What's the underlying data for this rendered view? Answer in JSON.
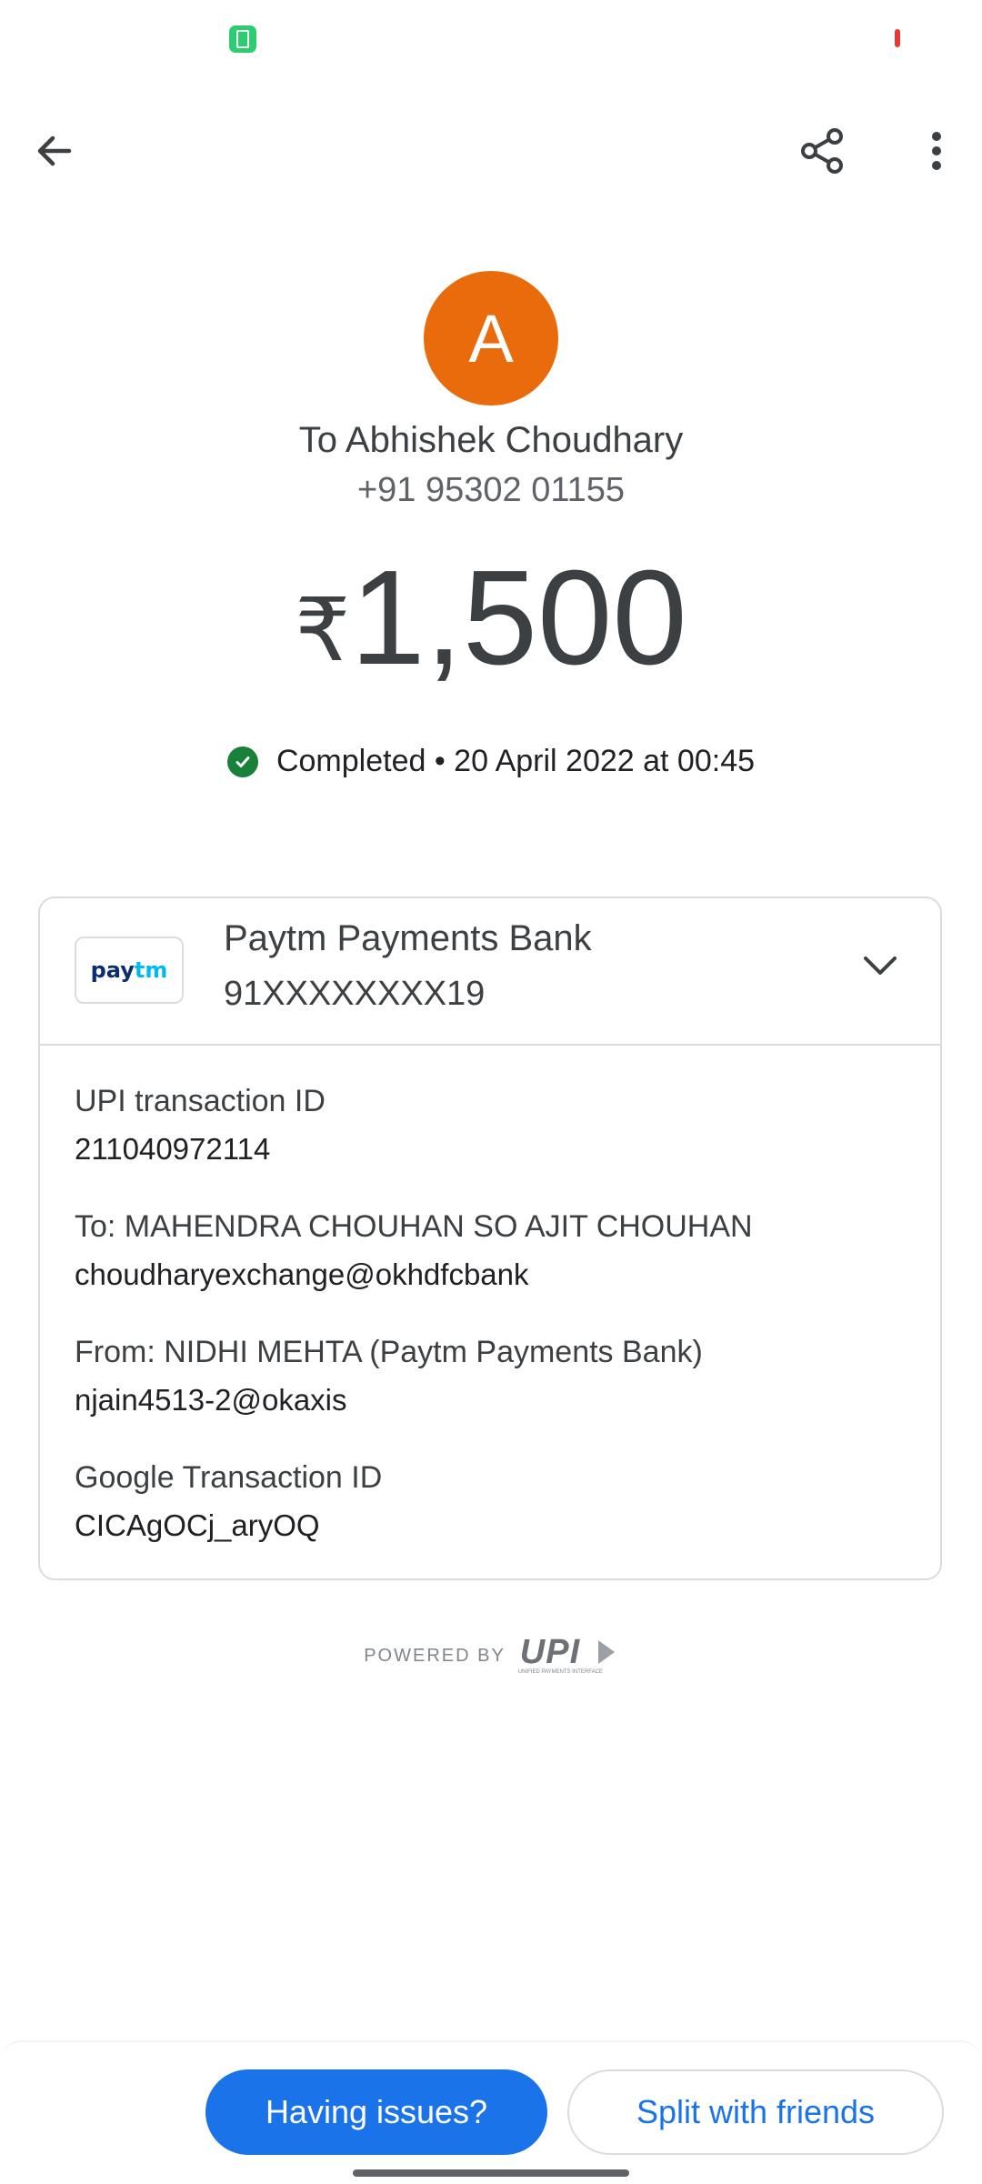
{
  "status_bar": {
    "battery_icon": "battery-icon",
    "indicator_color": "#e53935"
  },
  "top_bar": {
    "back_icon": "back-arrow-icon",
    "share_icon": "share-icon",
    "more_icon": "more-vert-icon"
  },
  "payee": {
    "avatar_letter": "A",
    "avatar_color": "#ea6b0c",
    "to_line": "To Abhishek Choudhary",
    "phone": "+91 95302 01155"
  },
  "amount": {
    "currency": "₹",
    "value": "1,500"
  },
  "status": {
    "icon": "check-circle-icon",
    "text": "Completed • 20 April 2022 at 00:45",
    "color": "#188038"
  },
  "card": {
    "bank_logo_pay": "pay",
    "bank_logo_tm": "tm",
    "bank_name": "Paytm Payments Bank",
    "account": "91XXXXXXXX19",
    "expand_icon": "chevron-down-icon",
    "details": [
      {
        "label": "UPI transaction ID",
        "value": "211040972114"
      },
      {
        "label": "To: MAHENDRA CHOUHAN SO AJIT CHOUHAN",
        "value": "choudharyexchange@okhdfcbank"
      },
      {
        "label": "From: NIDHI MEHTA (Paytm Payments Bank)",
        "value": "njain4513-2@okaxis"
      },
      {
        "label": "Google Transaction ID",
        "value": "CICAgOCj_aryOQ"
      }
    ]
  },
  "footer": {
    "powered_by": "POWERED BY",
    "upi_logo_text": "UPI",
    "upi_tagline": "UNIFIED PAYMENTS INTERFACE"
  },
  "actions": {
    "issues_label": "Having issues?",
    "split_label": "Split with friends"
  },
  "colors": {
    "accent": "#1a73e8",
    "text": "#3c4043"
  }
}
